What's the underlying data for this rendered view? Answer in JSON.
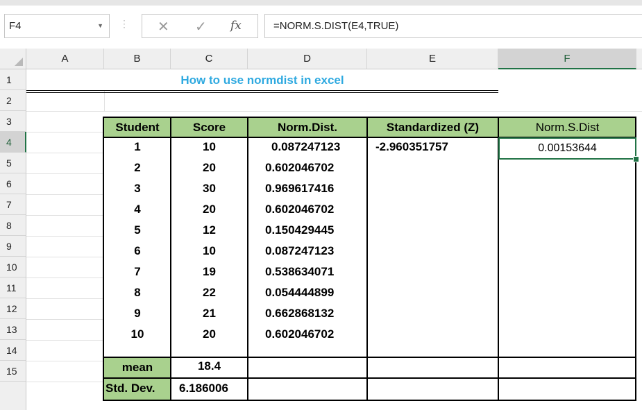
{
  "formula_bar": {
    "name_box": "F4",
    "separator": "⋮",
    "cancel_icon": "✕",
    "enter_icon": "✓",
    "fx_label": "fx",
    "formula": "=NORM.S.DIST(E4,TRUE)"
  },
  "columns": [
    "A",
    "B",
    "C",
    "D",
    "E",
    "F"
  ],
  "selected_column": "F",
  "rows": [
    "1",
    "2",
    "3",
    "4",
    "5",
    "6",
    "7",
    "8",
    "9",
    "10",
    "11",
    "12",
    "13",
    "14",
    "15"
  ],
  "selected_row": "4",
  "title": "How to use normdist in excel",
  "table": {
    "headers": [
      "Student",
      "Score",
      "Norm.Dist.",
      "Standardized (Z)",
      "Norm.S.Dist"
    ],
    "data": [
      [
        "1",
        "10",
        "0.087247123",
        "-2.960351757",
        "0.00153644"
      ],
      [
        "2",
        "20",
        "0.602046702",
        "",
        ""
      ],
      [
        "3",
        "30",
        "0.969617416",
        "",
        ""
      ],
      [
        "4",
        "20",
        "0.602046702",
        "",
        ""
      ],
      [
        "5",
        "12",
        "0.150429445",
        "",
        ""
      ],
      [
        "6",
        "10",
        "0.087247123",
        "",
        ""
      ],
      [
        "7",
        "19",
        "0.538634071",
        "",
        ""
      ],
      [
        "8",
        "22",
        "0.054444899",
        "",
        ""
      ],
      [
        "9",
        "21",
        "0.662868132",
        "",
        ""
      ],
      [
        "10",
        "20",
        "0.602046702",
        "",
        ""
      ]
    ],
    "summary": [
      [
        "mean",
        "18.4"
      ],
      [
        "Std. Dev.",
        "6.186006"
      ]
    ]
  },
  "colors": {
    "header_fill": "#a9d18e",
    "title_text": "#2ea9e0",
    "selection": "#217346"
  }
}
